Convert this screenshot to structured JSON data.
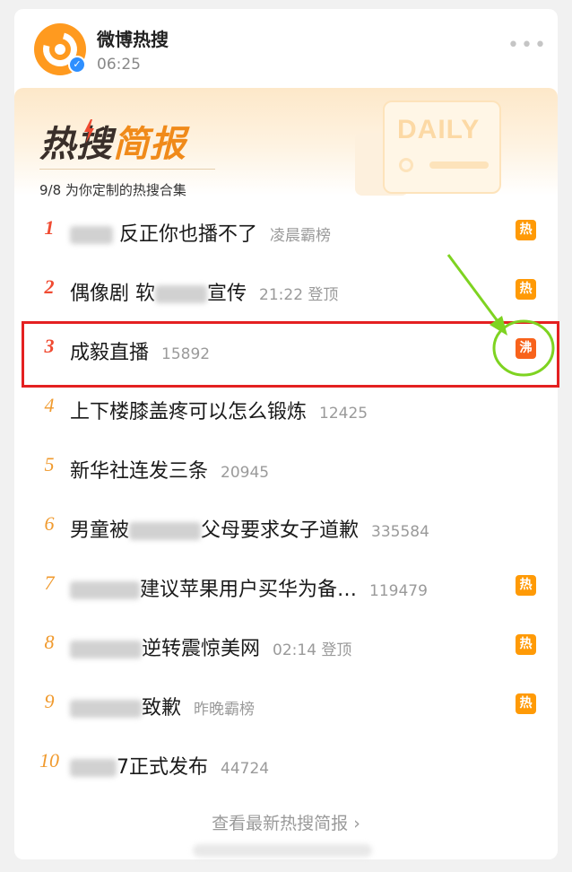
{
  "account": {
    "name": "微博热搜",
    "time": "06:25",
    "more_icon": "more-dots-icon",
    "verified_icon": "verified-check-icon"
  },
  "banner": {
    "brand_part1": "热搜",
    "brand_part2": "简报",
    "daily_tag": "DAILY",
    "subtitle": "9/8 为你定制的热搜合集"
  },
  "colors": {
    "rank_top": "#f04b32",
    "rank_rest": "#f09a2e",
    "badge_hot": "#ff9a06",
    "badge_boil": "#f8621b",
    "highlight_box": "#e42021",
    "annotation_arrow": "#7ed321"
  },
  "hot_list": [
    {
      "rank": "1",
      "title": "反正你也播不了",
      "meta": "凌晨霸榜",
      "badge": "热"
    },
    {
      "rank": "2",
      "title": "偶像剧 软",
      "title_tail": "宣传",
      "meta": "21:22 登顶",
      "badge": "热"
    },
    {
      "rank": "3",
      "title": "成毅直播",
      "meta": "15892",
      "badge": "沸"
    },
    {
      "rank": "4",
      "title": "上下楼膝盖疼可以怎么锻炼",
      "meta": "12425",
      "badge": ""
    },
    {
      "rank": "5",
      "title": "新华社连发三条",
      "meta": "20945",
      "badge": ""
    },
    {
      "rank": "6",
      "title": "男童被",
      "title_tail": "父母要求女子道歉",
      "meta": "335584",
      "badge": ""
    },
    {
      "rank": "7",
      "title": "建议苹果用户买华为备…",
      "meta": "119479",
      "badge": "热"
    },
    {
      "rank": "8",
      "title": "逆转震惊美网",
      "meta": "02:14 登顶",
      "badge": "热"
    },
    {
      "rank": "9",
      "title": "致歉",
      "meta": "昨晚霸榜",
      "badge": "热"
    },
    {
      "rank": "10",
      "title": "7正式发布",
      "meta": "44724",
      "badge": ""
    }
  ],
  "footer": {
    "link_text": "查看最新热搜简报",
    "chevron": "›"
  }
}
